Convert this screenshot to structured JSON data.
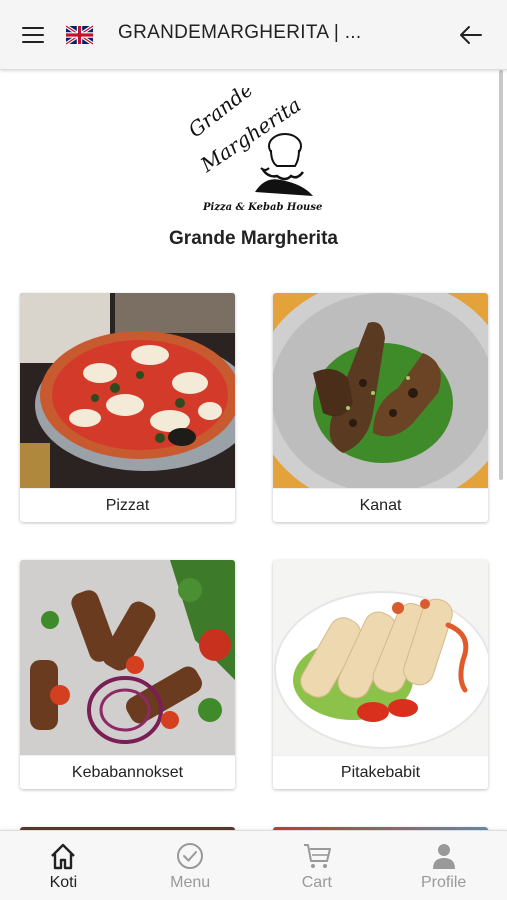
{
  "header": {
    "title": "GRANDEMARGHERITA | ...",
    "menu_icon": "hamburger-icon",
    "flag_icon": "uk-flag-icon",
    "back_icon": "arrow-left-icon"
  },
  "brand": {
    "logo_text_1": "Grande",
    "logo_text_2": "Margherita",
    "logo_tagline": "Pizza & Kebab House",
    "name": "Grande Margherita"
  },
  "categories": [
    {
      "label": "Pizzat",
      "image": "pizza-photo"
    },
    {
      "label": "Kanat",
      "image": "chicken-wings-photo"
    },
    {
      "label": "Kebabannokset",
      "image": "kebab-plate-photo"
    },
    {
      "label": "Pitakebabit",
      "image": "pita-rolls-photo"
    }
  ],
  "bottom_nav": {
    "items": [
      {
        "label": "Koti",
        "icon": "home-icon",
        "active": true
      },
      {
        "label": "Menu",
        "icon": "check-circle-icon",
        "active": false
      },
      {
        "label": "Cart",
        "icon": "cart-icon",
        "active": false
      },
      {
        "label": "Profile",
        "icon": "person-icon",
        "active": false
      }
    ]
  },
  "colors": {
    "active_nav": "#222222",
    "inactive_nav": "#999999",
    "appbar_bg": "#f5f5f5"
  }
}
